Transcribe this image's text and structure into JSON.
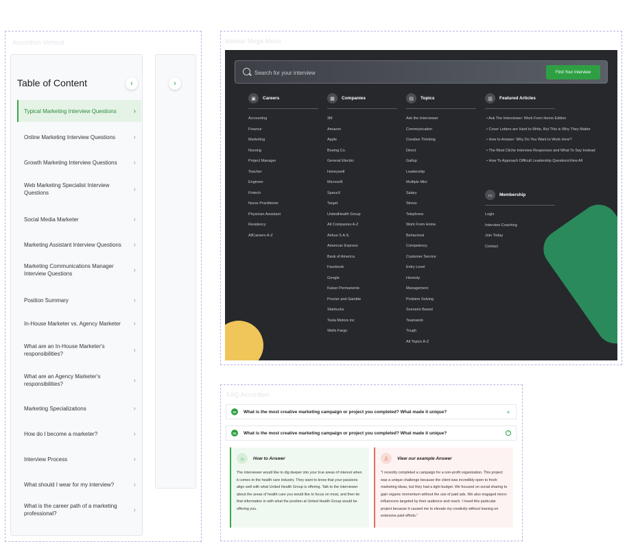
{
  "frame_labels": {
    "toc": "Accordion Vertical",
    "menu": "Navbar Mega Menu",
    "faq": "FAQ Accordion"
  },
  "toc": {
    "title": "Table of Content",
    "items": [
      {
        "label": "Typical Marketing Interview Questions",
        "active": true
      },
      {
        "label": "Online Marketing Interview Questions"
      },
      {
        "label": "Growth Marketing Interview Questions"
      },
      {
        "label": "Web Marketing Specialist Interview Questions"
      },
      {
        "label": "Social Media Marketer"
      },
      {
        "label": "Marketing Assistant Interview Questions"
      },
      {
        "label": "Marketing Communications Manager Interview Questions"
      },
      {
        "label": "Position Summary"
      },
      {
        "label": "In-House Marketer vs. Agency Marketer"
      },
      {
        "label": "What are an In-House Marketer's responsibilities?"
      },
      {
        "label": "What are an Agency Marketer's responsibilities?"
      },
      {
        "label": "Marketing Specializations"
      },
      {
        "label": "How do I become a marketer?"
      },
      {
        "label": "Interview Process"
      },
      {
        "label": "What should I wear for my interview?"
      },
      {
        "label": "What is the career path of a marketing professional?"
      }
    ],
    "collapse_icon": "chevron-left-icon",
    "expand_icon": "chevron-right-icon"
  },
  "menu": {
    "search_placeholder": "Search for your interview",
    "search_button": "Find Your Interview",
    "accent_color": "#2ea043",
    "columns": {
      "careers": {
        "title": "Careers",
        "links": [
          "Accounting",
          "Finance",
          "Marketing",
          "Nursing",
          "Project Manager",
          "Teacher",
          "Engineer",
          "Fintech",
          "Nurse Practitioner",
          "Physician Assistant",
          "Residency",
          "AllCareers A-Z"
        ]
      },
      "companies": {
        "title": "Companies",
        "links": [
          "3M",
          "Amazon",
          "Apple",
          "Boeing Co.",
          "General Electric",
          "Honeywell",
          "Microsoft",
          "SpaceX",
          "Target",
          "UnitedHealth Group",
          "All Companies A-Z",
          "Airbus S.A.S.",
          "American Express",
          "Bank of America",
          "Facebook",
          "Google",
          "Kaiser Permanente",
          "Procter and Gamble",
          "Starbucks",
          "Tesla Motors Inc",
          "Wells Fargo"
        ]
      },
      "topics": {
        "title": "Topics",
        "links": [
          "Ask the Interviewer",
          "Communication",
          "Creative Thinking",
          "Direct",
          "Gallup",
          "Leadership",
          "Multiple Mini",
          "Salary",
          "Stress",
          "Telephone",
          "Work From Home",
          "Behavioral",
          "Competency",
          "Customer Service",
          "Entry Level",
          "Honesty",
          "Management",
          "Problem Solving",
          "Scenario Based",
          "Teamwork",
          "Tough",
          "All Topics A-Z"
        ]
      },
      "articles": {
        "title": "Featured Articles",
        "links": [
          "Ask The Interviewer: Work From Home Edition",
          "Cover Letters are Hard to Write, But This is Why They Matter",
          "How to Answer: Why Do You Want to Work Here?",
          "The Most Cliche Interview Responses and What To Say Instead",
          "How To Approach Difficult Leadership QuestionsView All"
        ]
      },
      "membership": {
        "title": "Membership",
        "links": [
          "Login",
          "Interview Coaching",
          "Join Today",
          "Contact"
        ]
      }
    }
  },
  "faq": {
    "items": [
      {
        "num": "01",
        "question": "What is the most creative marketing campaign or project you completed? What made it unique?",
        "toggle": "+"
      },
      {
        "num": "01",
        "question": "What is the most creative marketing campaign or project you completed? What made it unique?",
        "toggle": "−"
      }
    ],
    "how_to_answer": {
      "title": "How to Answer",
      "body": "The interviewer would like to dig deeper into your true areas of interest when it comes to the health care industry. They want to know that your passions align well with what United Health Group is offering. Talk to the interviewer about the areas of health care you would like to focus on most, and then tie that information in with what the position at United Health Group would be offering you."
    },
    "example_answer": {
      "title": "View our example Answer",
      "body": "\"I recently completed a campaign for a non-profit organization. This project was a unique challenge because the client was incredibly open to fresh marketing ideas, but they had a tight budget. We focused on social sharing to gain organic momentum without the use of paid ads. We also engaged micro-influencers targeted by their audience and reach. I loved this particular project because it caused me to elevate my creativity without leaning on extensive paid efforts.\""
    }
  }
}
